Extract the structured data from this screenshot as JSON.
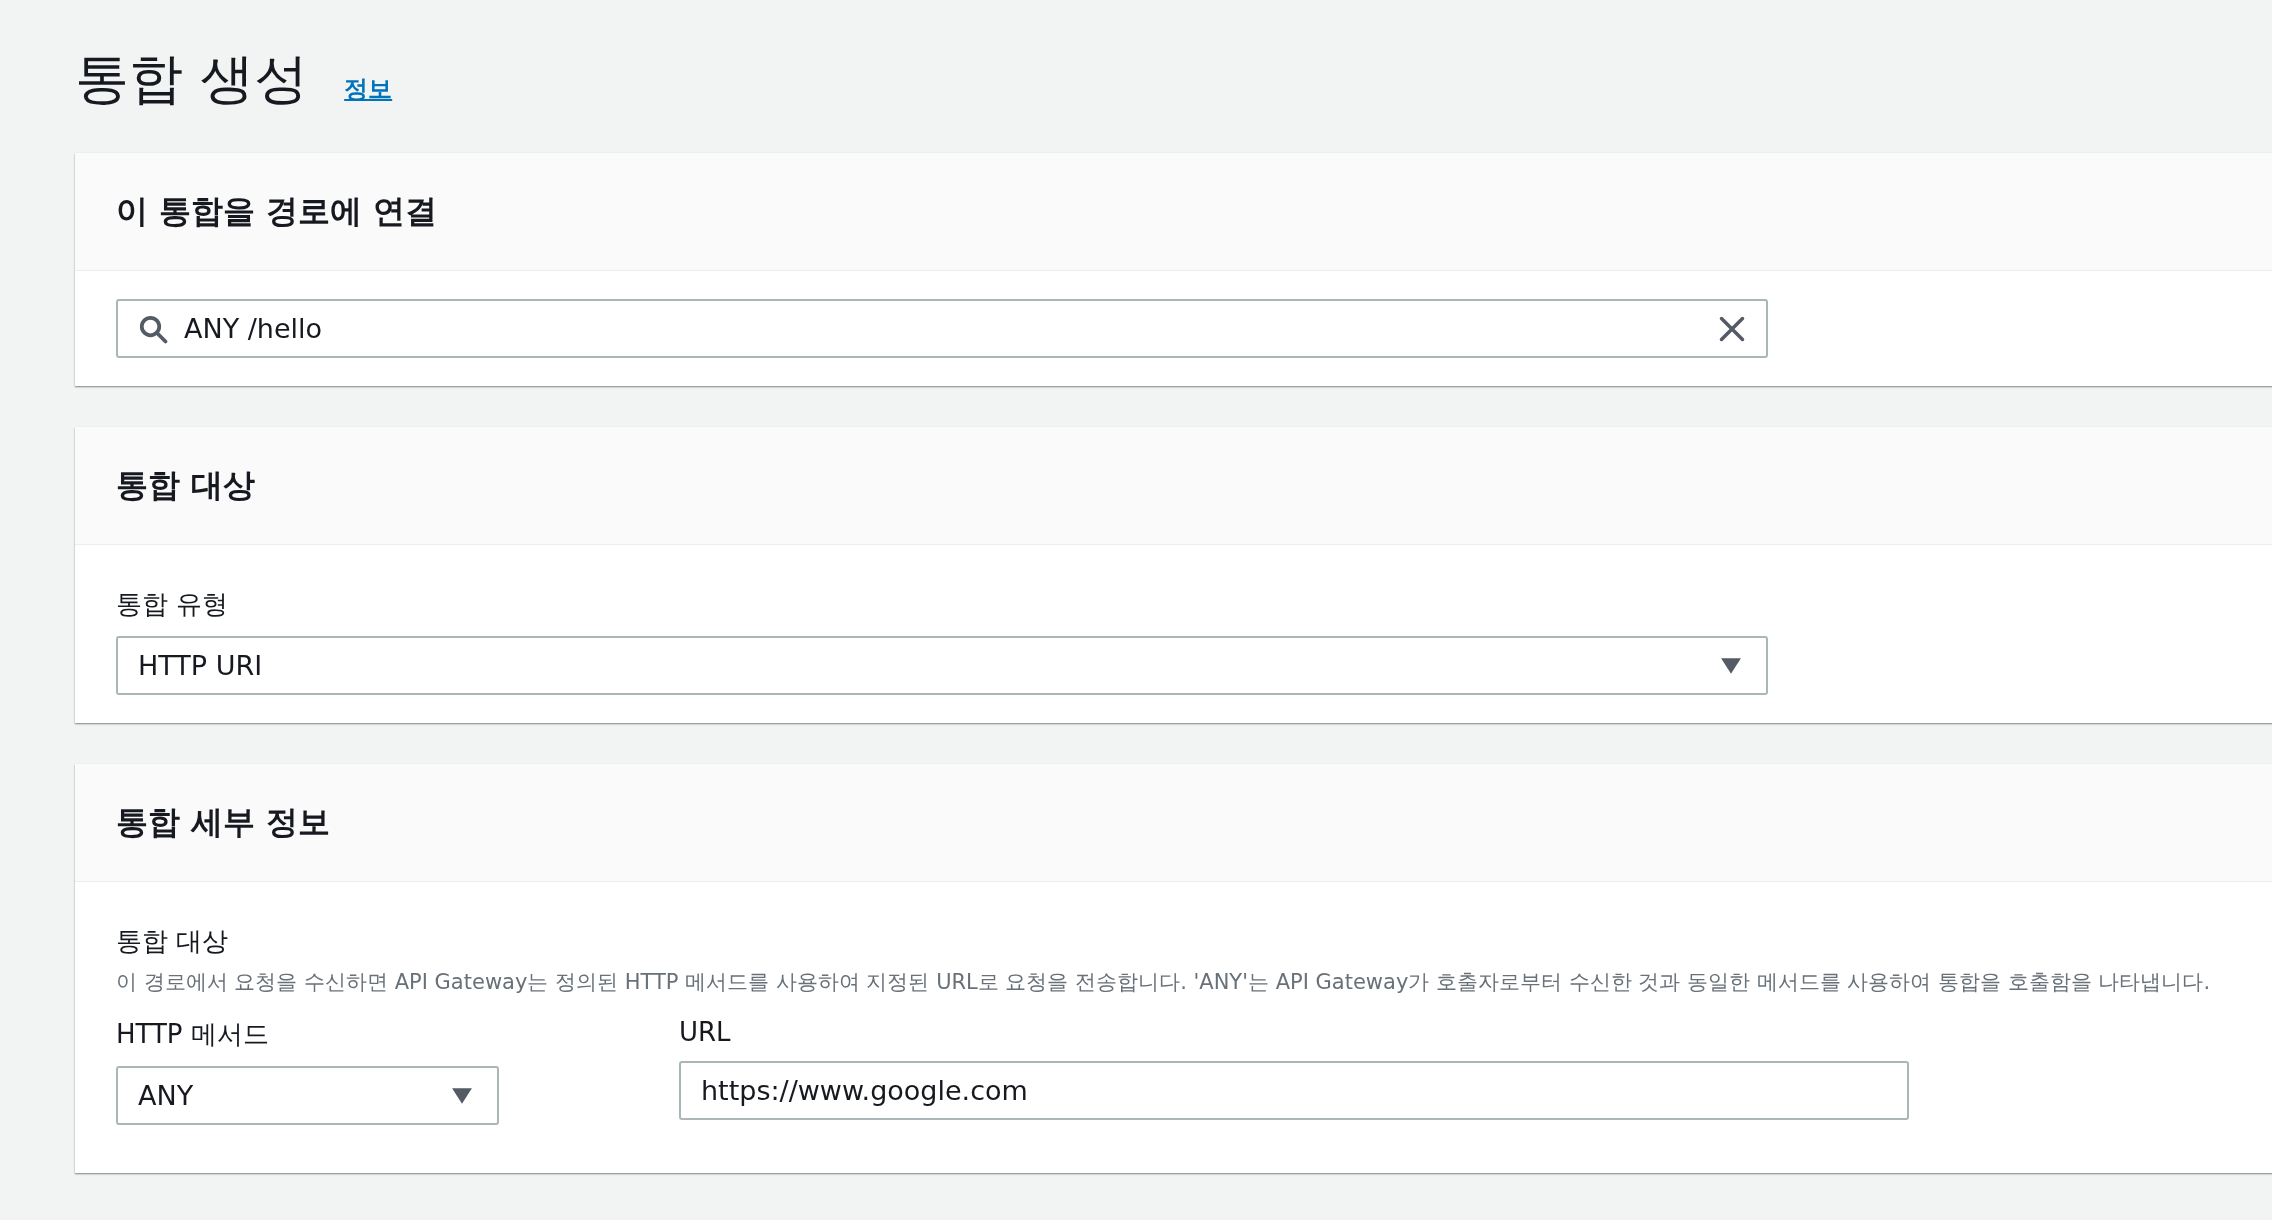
{
  "page": {
    "title": "통합 생성",
    "info_link": "정보"
  },
  "sections": [
    {
      "kind": "search",
      "title": "이 통합을 경로에 연결",
      "search": {
        "value": "ANY /hello"
      }
    },
    {
      "kind": "select",
      "title": "통합 대상",
      "field": {
        "label": "통합 유형",
        "value": "HTTP URI"
      }
    },
    {
      "kind": "details",
      "title": "통합 세부 정보",
      "label": "통합 대상",
      "description": "이 경로에서 요청을 수신하면 API Gateway는 정의된 HTTP 메서드를 사용하여 지정된 URL로 요청을 전송합니다. 'ANY'는 API Gateway가 호출자로부터 수신한 것과 동일한 메서드를 사용하여 통합을 호출함을 나타냅니다.",
      "method": {
        "label": "HTTP 메서드",
        "value": "ANY"
      },
      "url": {
        "label": "URL",
        "value": "https://www.google.com"
      }
    }
  ]
}
